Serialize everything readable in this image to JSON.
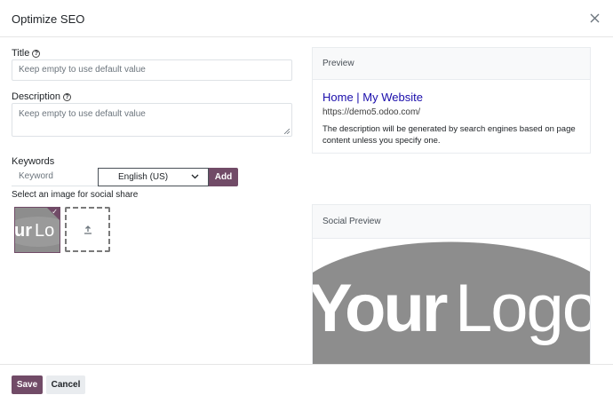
{
  "dialog": {
    "title": "Optimize SEO",
    "close_icon": "close-icon"
  },
  "form": {
    "title_label": "Title",
    "title_placeholder": "Keep empty to use default value",
    "title_value": "",
    "description_label": "Description",
    "description_placeholder": "Keep empty to use default value",
    "description_value": "",
    "help_icon": "question-circle-icon",
    "keywords_label": "Keywords",
    "keyword_placeholder": "Keyword",
    "language_selected": "English (US)",
    "add_label": "Add",
    "image_label": "Select an image for social share",
    "thumbnail_text": "urLo",
    "upload_icon": "upload-icon"
  },
  "preview": {
    "heading": "Preview",
    "page_title": "Home | My Website",
    "url": "https://demo5.odoo.com/",
    "description": "The description will be generated by search engines based on page content unless you specify one."
  },
  "social_preview": {
    "heading": "Social Preview",
    "logo_text": "YourLogo"
  },
  "footer": {
    "save_label": "Save",
    "cancel_label": "Cancel"
  },
  "colors": {
    "primary": "#714b67",
    "link": "#1a0dab",
    "logo_gray": "#8d8d8d"
  }
}
